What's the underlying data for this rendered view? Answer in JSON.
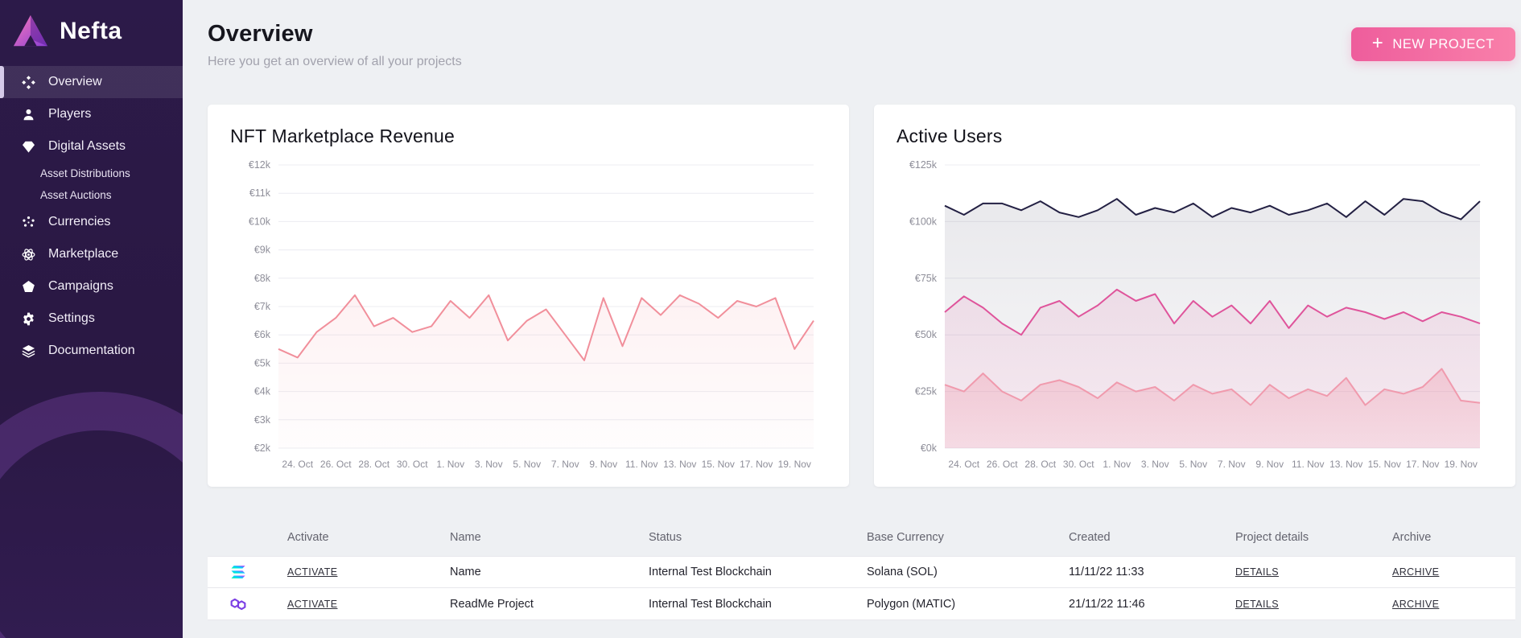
{
  "app": {
    "brand": "Nefta"
  },
  "sidebar": {
    "items": [
      {
        "label": "Overview",
        "icon": "overview-icon",
        "active": true
      },
      {
        "label": "Players",
        "icon": "players-icon"
      },
      {
        "label": "Digital Assets",
        "icon": "digital-assets-icon",
        "children": [
          "Asset Distributions",
          "Asset Auctions"
        ]
      },
      {
        "label": "Currencies",
        "icon": "currencies-icon"
      },
      {
        "label": "Marketplace",
        "icon": "marketplace-icon"
      },
      {
        "label": "Campaigns",
        "icon": "campaigns-icon"
      },
      {
        "label": "Settings",
        "icon": "settings-icon"
      },
      {
        "label": "Documentation",
        "icon": "documentation-icon"
      }
    ]
  },
  "header": {
    "title": "Overview",
    "subtitle": "Here you get an overview of all your projects",
    "new_project_label": "NEW PROJECT",
    "accent_color": "#ee5d9c"
  },
  "chart_data": [
    {
      "type": "line",
      "title": "NFT Marketplace Revenue",
      "xlabel": "",
      "ylabel": "",
      "grid": true,
      "legend": false,
      "ylim": [
        2000,
        12000
      ],
      "yticks": [
        {
          "v": 2000,
          "label": "€2k"
        },
        {
          "v": 3000,
          "label": "€3k"
        },
        {
          "v": 4000,
          "label": "€4k"
        },
        {
          "v": 5000,
          "label": "€5k"
        },
        {
          "v": 6000,
          "label": "€6k"
        },
        {
          "v": 7000,
          "label": "€7k"
        },
        {
          "v": 8000,
          "label": "€8k"
        },
        {
          "v": 9000,
          "label": "€9k"
        },
        {
          "v": 10000,
          "label": "€10k"
        },
        {
          "v": 11000,
          "label": "€11k"
        },
        {
          "v": 12000,
          "label": "€12k"
        }
      ],
      "x_labels": [
        "24. Oct",
        "26. Oct",
        "28. Oct",
        "30. Oct",
        "1. Nov",
        "3. Nov",
        "5. Nov",
        "7. Nov",
        "9. Nov",
        "11. Nov",
        "13. Nov",
        "15. Nov",
        "17. Nov",
        "19. Nov"
      ],
      "label_start_index": 1,
      "label_step": 2,
      "series": [
        {
          "name": "revenue",
          "color": "#f18f9b",
          "fill_top": 0.12,
          "fill_bottom": 0.02,
          "values": [
            5500,
            5200,
            6100,
            6600,
            7400,
            6300,
            6600,
            6100,
            6300,
            7200,
            6600,
            7400,
            5800,
            6500,
            6900,
            6000,
            5100,
            7300,
            5600,
            7300,
            6700,
            7400,
            7100,
            6600,
            7200,
            7000,
            7300,
            5500,
            6500
          ]
        }
      ]
    },
    {
      "type": "line",
      "title": "Active Users",
      "xlabel": "",
      "ylabel": "",
      "grid": true,
      "legend": false,
      "ylim": [
        0,
        125000
      ],
      "yticks": [
        {
          "v": 0,
          "label": "€0k"
        },
        {
          "v": 25000,
          "label": "€25k"
        },
        {
          "v": 50000,
          "label": "€50k"
        },
        {
          "v": 75000,
          "label": "€75k"
        },
        {
          "v": 100000,
          "label": "€100k"
        },
        {
          "v": 125000,
          "label": "€125k"
        }
      ],
      "x_labels": [
        "24. Oct",
        "26. Oct",
        "28. Oct",
        "30. Oct",
        "1. Nov",
        "3. Nov",
        "5. Nov",
        "7. Nov",
        "9. Nov",
        "11. Nov",
        "13. Nov",
        "15. Nov",
        "17. Nov",
        "19. Nov"
      ],
      "label_start_index": 1,
      "label_step": 2,
      "series": [
        {
          "name": "series-1",
          "color": "#232043",
          "fill_top": 0.1,
          "fill_bottom": 0.03,
          "values": [
            107000,
            103000,
            108000,
            108000,
            105000,
            109000,
            104000,
            102000,
            105000,
            110000,
            103000,
            106000,
            104000,
            108000,
            102000,
            106000,
            104000,
            107000,
            103000,
            105000,
            108000,
            102000,
            109000,
            103000,
            110000,
            109000,
            104000,
            101000,
            109000
          ]
        },
        {
          "name": "series-2",
          "color": "#df549b",
          "fill_top": 0.12,
          "fill_bottom": 0.08,
          "values": [
            60000,
            67000,
            62000,
            55000,
            50000,
            62000,
            65000,
            58000,
            63000,
            70000,
            65000,
            68000,
            55000,
            65000,
            58000,
            63000,
            55000,
            65000,
            53000,
            63000,
            58000,
            62000,
            60000,
            57000,
            60000,
            56000,
            60000,
            58000,
            55000
          ]
        },
        {
          "name": "series-3",
          "color": "#f09aad",
          "fill_top": 0.38,
          "fill_bottom": 0.2,
          "values": [
            28000,
            25000,
            33000,
            25000,
            21000,
            28000,
            30000,
            27000,
            22000,
            29000,
            25000,
            27000,
            21000,
            28000,
            24000,
            26000,
            19000,
            28000,
            22000,
            26000,
            23000,
            31000,
            19000,
            26000,
            24000,
            27000,
            35000,
            21000,
            20000
          ]
        }
      ]
    }
  ],
  "table": {
    "columns": [
      "Activate",
      "Name",
      "Status",
      "Base Currency",
      "Created",
      "Project details",
      "Archive"
    ],
    "rows": [
      {
        "chain": "solana-icon",
        "activate_label": "ACTIVATE",
        "name": "Name",
        "status": "Internal Test Blockchain",
        "base_currency": "Solana (SOL)",
        "created": "11/11/22 11:33",
        "details_label": "DETAILS",
        "archive_label": "ARCHIVE"
      },
      {
        "chain": "polygon-icon",
        "activate_label": "ACTIVATE",
        "name": "ReadMe Project",
        "status": "Internal Test Blockchain",
        "base_currency": "Polygon (MATIC)",
        "created": "21/11/22 11:46",
        "details_label": "DETAILS",
        "archive_label": "ARCHIVE"
      }
    ]
  }
}
